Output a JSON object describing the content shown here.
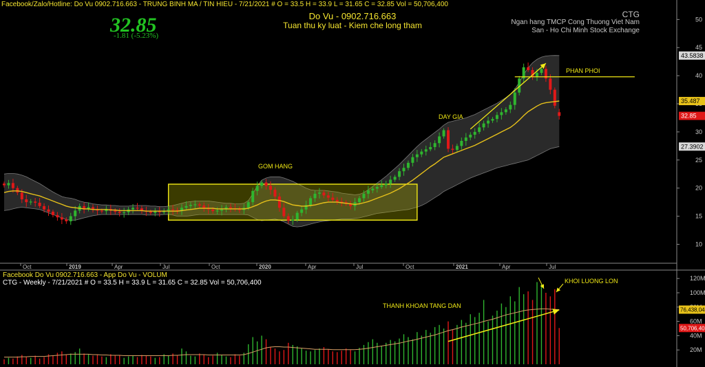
{
  "colors": {
    "up": "#2fb52f",
    "down": "#e01818",
    "ma": "#e8c21a",
    "band_fill": "#2a2a2a",
    "band_line": "#7a7a7a",
    "annot": "#f2ea16",
    "price_big": "#22c322",
    "grid_text": "#c8c8c8",
    "header_yellow": "#f5e530",
    "header_white": "#ffffff",
    "label_red": "#e01818",
    "tag_bg": "#d8d8d8"
  },
  "header": {
    "line1": "Facebook/Zalo/Hotline: Do Vu 0902.716.663 - TRUNG BINH MA / TIN HIEU   - 7/21/2021   #   O = 33.5  H = 33.9  L = 31.65  C = 32.85  Vol = 50,706,400",
    "big_price": "32.85",
    "change": "-1.81  (-5.23%)",
    "author": "Do Vu - 0902.716.663",
    "slogan": "Tuan thu ky luat - Kiem che long tham",
    "ticker": "CTG",
    "company": "Ngan hang TMCP Cong Thuong Viet Nam",
    "exchange": "San - Ho Chi Minh Stock Exchange"
  },
  "volume_header": {
    "line1": "Facebook Do Vu 0902.716.663 - App Do Vu - VOLUM",
    "line2": "CTG - Weekly  - 7/21/2021   #   O = 33.5  H = 33.9  L = 31.65  C = 32.85  Vol = 50,706,400"
  },
  "chart_data": [
    {
      "type": "candlestick",
      "interval": "weekly",
      "x_axis_labels": [
        "Oct",
        "2019",
        "Apr",
        "Jul",
        "Oct",
        "2020",
        "Apr",
        "Jul",
        "Oct",
        "2021",
        "Apr",
        "Jul"
      ],
      "y_ticks": [
        "50",
        "45",
        "40",
        "35",
        "30",
        "25",
        "20",
        "15",
        "10"
      ],
      "ylim": [
        7,
        52
      ],
      "last_close": 32.85,
      "price_tags": [
        {
          "label": "43.5838",
          "value": 43.5838,
          "style": "grey"
        },
        {
          "label": "35.487",
          "value": 35.487,
          "style": "yellow"
        },
        {
          "label": "32.85",
          "value": 32.85,
          "style": "red"
        },
        {
          "label": "27.3902",
          "value": 27.3902,
          "style": "grey"
        }
      ],
      "close": [
        20.5,
        20.9,
        20.0,
        19.2,
        18.0,
        17.5,
        17.6,
        17.4,
        16.8,
        16.2,
        15.8,
        15.2,
        14.8,
        14.4,
        14.1,
        15.0,
        16.0,
        16.8,
        16.2,
        16.6,
        16.2,
        16.0,
        15.9,
        16.3,
        16.0,
        15.8,
        15.6,
        15.7,
        16.2,
        16.5,
        16.4,
        16.0,
        15.8,
        15.6,
        15.9,
        15.7,
        16.0,
        16.2,
        16.1,
        15.9,
        16.5,
        16.8,
        17.0,
        17.1,
        16.9,
        16.4,
        16.2,
        15.9,
        16.0,
        16.2,
        16.6,
        16.4,
        16.2,
        16.1,
        16.5,
        17.5,
        19.5,
        20.4,
        21.0,
        20.4,
        19.7,
        18.5,
        16.5,
        15.0,
        14.2,
        14.4,
        15.6,
        16.2,
        17.0,
        18.2,
        19.0,
        19.2,
        18.7,
        18.3,
        17.9,
        17.6,
        17.5,
        17.2,
        16.8,
        17.5,
        18.2,
        19.0,
        19.6,
        19.9,
        20.2,
        20.5,
        20.8,
        21.5,
        22.0,
        23.0,
        23.6,
        24.5,
        25.5,
        26.0,
        26.5,
        26.9,
        27.3,
        28.0,
        29.2,
        30.3,
        27.0,
        26.8,
        27.5,
        28.4,
        29.0,
        29.5,
        30.0,
        30.8,
        31.5,
        32.0,
        32.3,
        33.0,
        33.5,
        34.0,
        34.8,
        37.0,
        39.5,
        41.5,
        41.0,
        39.8,
        40.5,
        41.2,
        39.5,
        37.5,
        34.66,
        32.85
      ],
      "open": [
        20.8,
        20.5,
        20.9,
        20.0,
        19.2,
        18.0,
        17.5,
        17.6,
        17.4,
        16.8,
        16.2,
        15.8,
        15.2,
        14.8,
        14.4,
        14.1,
        15.0,
        16.0,
        16.8,
        16.2,
        16.6,
        16.2,
        16.0,
        15.9,
        16.3,
        16.0,
        15.8,
        15.6,
        15.7,
        16.2,
        16.5,
        16.4,
        16.0,
        15.8,
        15.6,
        15.9,
        15.7,
        16.0,
        16.2,
        16.1,
        15.9,
        16.5,
        16.8,
        17.0,
        17.1,
        16.9,
        16.4,
        16.2,
        15.9,
        16.0,
        16.2,
        16.6,
        16.4,
        16.2,
        16.1,
        16.5,
        17.5,
        19.5,
        20.4,
        21.0,
        20.4,
        19.7,
        18.5,
        16.5,
        15.0,
        14.2,
        14.4,
        15.6,
        16.2,
        17.0,
        18.2,
        19.0,
        19.2,
        18.7,
        18.3,
        17.9,
        17.6,
        17.5,
        17.2,
        16.8,
        17.5,
        18.2,
        19.0,
        19.6,
        19.9,
        20.2,
        20.5,
        20.8,
        21.5,
        22.0,
        23.0,
        23.6,
        24.5,
        25.5,
        26.0,
        26.5,
        26.9,
        27.3,
        28.0,
        29.2,
        30.3,
        27.0,
        26.8,
        27.5,
        28.4,
        29.0,
        29.5,
        30.0,
        30.8,
        31.5,
        32.0,
        32.3,
        33.0,
        33.5,
        34.0,
        34.8,
        37.0,
        39.5,
        41.5,
        41.0,
        39.8,
        40.5,
        41.2,
        39.5,
        37.5,
        33.5
      ],
      "ma_line": [
        19.2,
        19.4,
        19.5,
        19.5,
        19.4,
        19.2,
        19.0,
        18.8,
        18.6,
        18.3,
        18.0,
        17.7,
        17.4,
        17.1,
        16.8,
        16.6,
        16.5,
        16.4,
        16.3,
        16.3,
        16.2,
        16.2,
        16.2,
        16.2,
        16.1,
        16.1,
        16.0,
        16.0,
        16.0,
        16.0,
        16.0,
        16.0,
        15.9,
        15.9,
        15.9,
        15.9,
        15.9,
        15.9,
        15.9,
        15.9,
        16.0,
        16.1,
        16.2,
        16.3,
        16.4,
        16.4,
        16.4,
        16.4,
        16.3,
        16.3,
        16.3,
        16.3,
        16.3,
        16.3,
        16.3,
        16.4,
        16.7,
        17.0,
        17.4,
        17.7,
        17.9,
        17.9,
        17.8,
        17.6,
        17.3,
        17.0,
        16.9,
        16.8,
        16.8,
        16.9,
        17.0,
        17.2,
        17.4,
        17.5,
        17.5,
        17.5,
        17.4,
        17.3,
        17.2,
        17.1,
        17.2,
        17.4,
        17.6,
        17.9,
        18.2,
        18.5,
        18.8,
        19.1,
        19.5,
        19.9,
        20.4,
        20.9,
        21.4,
        22.0,
        22.6,
        23.2,
        23.8,
        24.3,
        24.9,
        25.5,
        25.8,
        26.1,
        26.4,
        26.7,
        27.0,
        27.3,
        27.6,
        28.0,
        28.4,
        28.8,
        29.2,
        29.6,
        30.0,
        30.4,
        30.8,
        31.4,
        32.1,
        32.9,
        33.6,
        34.1,
        34.6,
        35.0,
        35.2,
        35.3,
        35.4,
        35.487
      ],
      "band_upper": [
        22.5,
        22.6,
        22.6,
        22.5,
        22.3,
        22.0,
        21.6,
        21.2,
        20.8,
        20.3,
        19.8,
        19.3,
        18.9,
        18.5,
        18.3,
        18.2,
        18.0,
        17.7,
        17.5,
        17.4,
        17.2,
        17.1,
        17.0,
        17.0,
        16.9,
        16.9,
        16.8,
        16.8,
        16.8,
        16.9,
        16.9,
        16.9,
        16.9,
        16.8,
        16.8,
        16.7,
        16.7,
        16.8,
        16.9,
        17.1,
        17.3,
        17.5,
        17.6,
        17.7,
        17.7,
        17.7,
        17.7,
        17.6,
        17.5,
        17.4,
        17.3,
        17.3,
        17.2,
        17.2,
        17.3,
        17.8,
        19.0,
        20.4,
        21.4,
        21.8,
        22.0,
        22.0,
        22.0,
        21.8,
        21.5,
        21.2,
        20.8,
        20.4,
        20.0,
        19.7,
        19.6,
        19.6,
        19.6,
        19.5,
        19.4,
        19.3,
        19.1,
        19.0,
        18.9,
        18.8,
        18.9,
        19.2,
        19.7,
        20.3,
        20.9,
        21.5,
        22.1,
        22.8,
        23.5,
        24.2,
        25.0,
        25.8,
        26.6,
        27.4,
        28.1,
        28.7,
        29.3,
        29.9,
        30.5,
        31.2,
        31.7,
        31.9,
        32.1,
        32.3,
        32.5,
        32.8,
        33.1,
        33.5,
        33.9,
        34.3,
        34.7,
        35.1,
        35.6,
        36.1,
        36.7,
        37.6,
        38.8,
        40.2,
        41.4,
        42.3,
        42.9,
        43.3,
        43.5,
        43.58,
        43.6,
        43.5838
      ],
      "band_lower": [
        16.0,
        16.1,
        16.3,
        16.5,
        16.6,
        16.5,
        16.4,
        16.3,
        16.2,
        15.9,
        15.6,
        15.3,
        15.0,
        14.7,
        14.4,
        14.3,
        14.3,
        14.5,
        14.7,
        14.9,
        15.1,
        15.2,
        15.3,
        15.3,
        15.3,
        15.3,
        15.3,
        15.3,
        15.3,
        15.3,
        15.3,
        15.3,
        15.2,
        15.2,
        15.2,
        15.2,
        15.3,
        15.3,
        15.2,
        15.0,
        15.0,
        15.0,
        15.1,
        15.2,
        15.3,
        15.3,
        15.3,
        15.3,
        15.3,
        15.3,
        15.3,
        15.3,
        15.3,
        15.3,
        15.3,
        15.2,
        14.8,
        14.4,
        14.2,
        14.3,
        14.4,
        14.5,
        14.3,
        14.0,
        13.6,
        13.2,
        13.1,
        13.2,
        13.4,
        13.6,
        13.8,
        14.0,
        14.1,
        14.2,
        14.3,
        14.4,
        14.5,
        14.5,
        14.5,
        14.6,
        14.7,
        14.9,
        15.1,
        15.3,
        15.5,
        15.6,
        15.7,
        15.8,
        15.9,
        16.0,
        16.1,
        16.2,
        16.4,
        16.6,
        16.9,
        17.3,
        17.8,
        18.3,
        18.8,
        19.4,
        19.8,
        20.2,
        20.6,
        21.0,
        21.4,
        21.8,
        22.1,
        22.4,
        22.7,
        23.0,
        23.3,
        23.6,
        23.8,
        24.0,
        24.2,
        24.4,
        24.6,
        24.8,
        25.0,
        25.4,
        25.8,
        26.2,
        26.6,
        27.0,
        27.2,
        27.3902
      ],
      "annotations": [
        {
          "text": "GOM HANG",
          "value": 23.5
        },
        {
          "text": "DAY GIA",
          "value": 32.3
        },
        {
          "text": "PHAN PHOI",
          "value": 40.5
        }
      ],
      "accumulation_box": {
        "from_week": 37,
        "to_week": 93,
        "high": 20.7,
        "low": 14.3
      },
      "distribution_line": {
        "from_week": 115,
        "to_week": 142,
        "value": 39.8
      },
      "trend_arrow": {
        "from_week": 105,
        "from_value": 30.5,
        "to_week": 122,
        "to_value": 42.2
      }
    },
    {
      "type": "bar",
      "series": "volume",
      "y_ticks": [
        "120M",
        "100M",
        "80M",
        "60M",
        "40M",
        "20M"
      ],
      "ylim": [
        0,
        125
      ],
      "price_tags": [
        {
          "label": "76,438,04",
          "value": 76.438,
          "style": "yellow"
        },
        {
          "label": "50,706,40",
          "value": 50.706,
          "style": "red"
        }
      ],
      "values": [
        7,
        9,
        8,
        11,
        13,
        10,
        9,
        12,
        8,
        10,
        14,
        12,
        16,
        18,
        13,
        15,
        17,
        22,
        15,
        14,
        12,
        13,
        11,
        10,
        14,
        12,
        13,
        9,
        11,
        12,
        10,
        13,
        12,
        11,
        9,
        10,
        14,
        12,
        15,
        13,
        22,
        18,
        12,
        11,
        15,
        13,
        10,
        12,
        16,
        13,
        11,
        10,
        14,
        12,
        16,
        28,
        38,
        32,
        40,
        35,
        24,
        22,
        18,
        20,
        30,
        27,
        25,
        22,
        19,
        18,
        20,
        22,
        24,
        21,
        18,
        17,
        19,
        22,
        20,
        18,
        23,
        27,
        31,
        35,
        30,
        26,
        30,
        34,
        32,
        36,
        42,
        38,
        35,
        45,
        40,
        48,
        44,
        52,
        55,
        50,
        60,
        48,
        55,
        62,
        58,
        70,
        66,
        72,
        90,
        60,
        68,
        75,
        85,
        80,
        95,
        88,
        108,
        98,
        102,
        90,
        115,
        112,
        100,
        95,
        105,
        50.7
      ],
      "ma_line": [
        10,
        10,
        10,
        10,
        10.5,
        10.5,
        11,
        11,
        11,
        11,
        11.5,
        12,
        12.5,
        13,
        13.5,
        14,
        14,
        14,
        14,
        14,
        13.5,
        13.5,
        13,
        13,
        12.5,
        12.5,
        12.5,
        12,
        12,
        12,
        12,
        12,
        12,
        12,
        12,
        12,
        12,
        12,
        12.5,
        12.5,
        13,
        13.5,
        13.5,
        13.5,
        13.5,
        13.5,
        13,
        13,
        13,
        13,
        13,
        13,
        13,
        13,
        13.5,
        15,
        17,
        19,
        21,
        23,
        24,
        24.5,
        24.5,
        24,
        24,
        23.5,
        23,
        22.5,
        22,
        21.5,
        21,
        21,
        21,
        21,
        20.5,
        20.5,
        20.5,
        20.5,
        20.5,
        20.5,
        21,
        21.5,
        22.5,
        23.5,
        24.5,
        25.5,
        26.5,
        27.5,
        28.5,
        29.5,
        31,
        32.5,
        33.5,
        35,
        36.5,
        38,
        39.5,
        41,
        43,
        45,
        47,
        48.5,
        50,
        52,
        53.5,
        55,
        56.5,
        58,
        60,
        61.5,
        63,
        65,
        67,
        69,
        70.5,
        72,
        73.5,
        75,
        76,
        76.5,
        77,
        77.5,
        77.5,
        77,
        76.7,
        76.438
      ],
      "annotations": [
        {
          "text": "THANH KHOAN TANG DAN",
          "value": 74
        },
        {
          "text": "KHOI LUONG LON",
          "value": 108
        }
      ],
      "trend_arrow": {
        "from_week": 100,
        "from_value": 32,
        "to_week": 125,
        "to_value": 76
      }
    }
  ]
}
